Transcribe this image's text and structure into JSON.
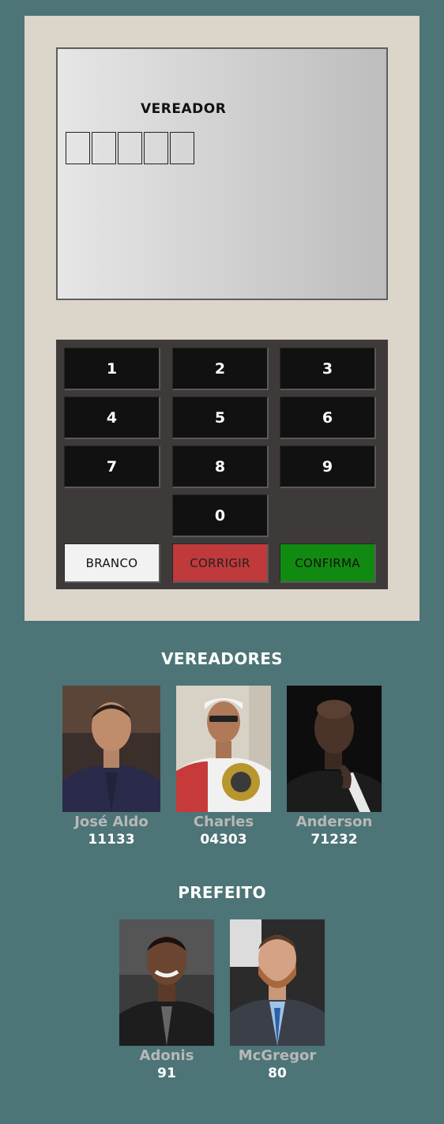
{
  "urna": {
    "cargo": "VEREADOR",
    "digitos": [
      "",
      "",
      "",
      "",
      ""
    ],
    "teclas": [
      "1",
      "2",
      "3",
      "4",
      "5",
      "6",
      "7",
      "8",
      "9",
      "0"
    ],
    "branco_label": "BRANCO",
    "corrigir_label": "CORRIGIR",
    "confirma_label": "CONFIRMA"
  },
  "vereadores": {
    "titulo": "VEREADORES",
    "candidatos": [
      {
        "nome": "José Aldo",
        "numero": "11133"
      },
      {
        "nome": "Charles",
        "numero": "04303"
      },
      {
        "nome": "Anderson",
        "numero": "71232"
      }
    ]
  },
  "prefeito": {
    "titulo": "PREFEITO",
    "candidatos": [
      {
        "nome": "Adonis",
        "numero": "91"
      },
      {
        "nome": "McGregor",
        "numero": "80"
      }
    ]
  },
  "colors": {
    "page_bg": "#4d7477",
    "urna_bg": "#dcd5ca",
    "teclado_bg": "#3f3a3a",
    "tecla_bg": "#111111",
    "branco": "#f2f2f2",
    "corrigir": "#c0393b",
    "confirma": "#118a11"
  }
}
